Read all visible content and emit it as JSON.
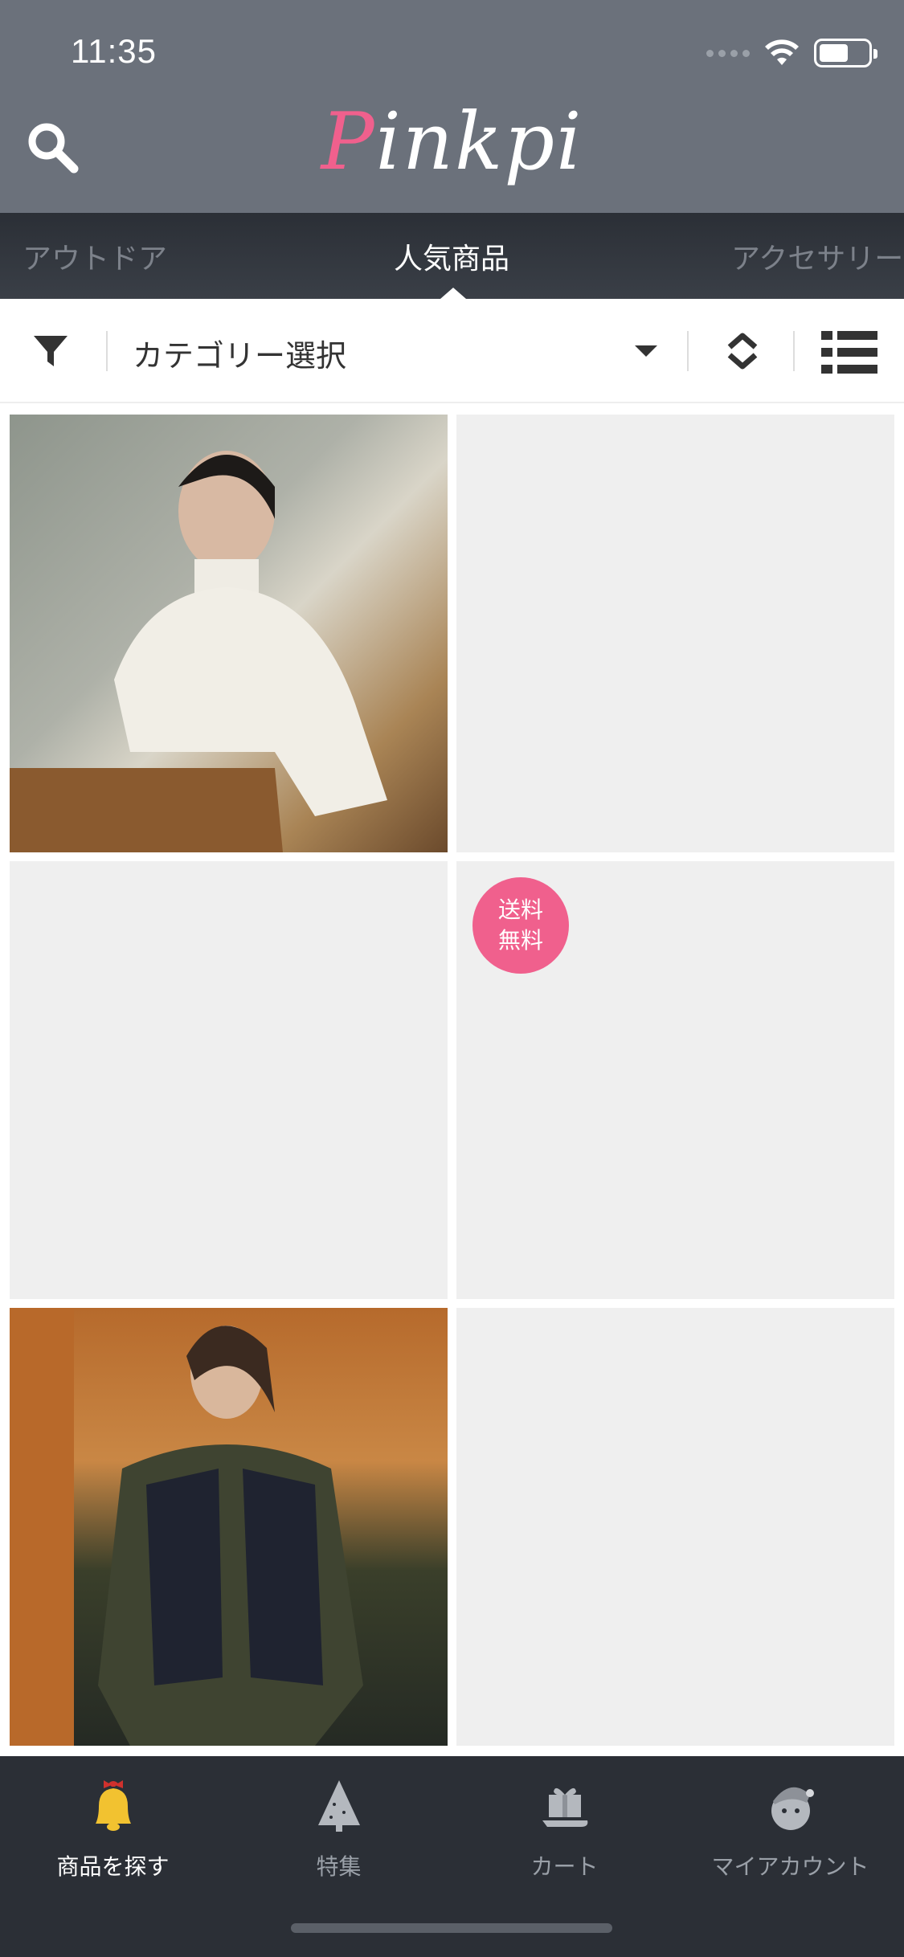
{
  "status": {
    "time": "11:35"
  },
  "header": {
    "logo": "Pinkpi"
  },
  "tabs": [
    {
      "label": "アウトドア",
      "active": false
    },
    {
      "label": "人気商品",
      "active": true
    },
    {
      "label": "アクセサリー",
      "active": false
    }
  ],
  "filter": {
    "category_label": "カテゴリー選択"
  },
  "grid": {
    "items": [
      {
        "kind": "photo"
      },
      {
        "kind": "blank"
      },
      {
        "kind": "blank"
      },
      {
        "kind": "blank",
        "badge": "送料\n無料"
      },
      {
        "kind": "photo"
      },
      {
        "kind": "blank"
      }
    ],
    "badge_line1": "送料",
    "badge_line2": "無料"
  },
  "bottom_nav": {
    "items": [
      {
        "label": "商品を探す",
        "icon": "bell-icon",
        "active": true
      },
      {
        "label": "特集",
        "icon": "tree-icon",
        "active": false
      },
      {
        "label": "カート",
        "icon": "gift-cart-icon",
        "active": false
      },
      {
        "label": "マイアカウント",
        "icon": "snowman-icon",
        "active": false
      }
    ]
  },
  "colors": {
    "accent": "#f0608d",
    "header_bg": "#6b717b",
    "tabs_bg": "#2b2f36",
    "nav_bg": "#2b2f36"
  }
}
